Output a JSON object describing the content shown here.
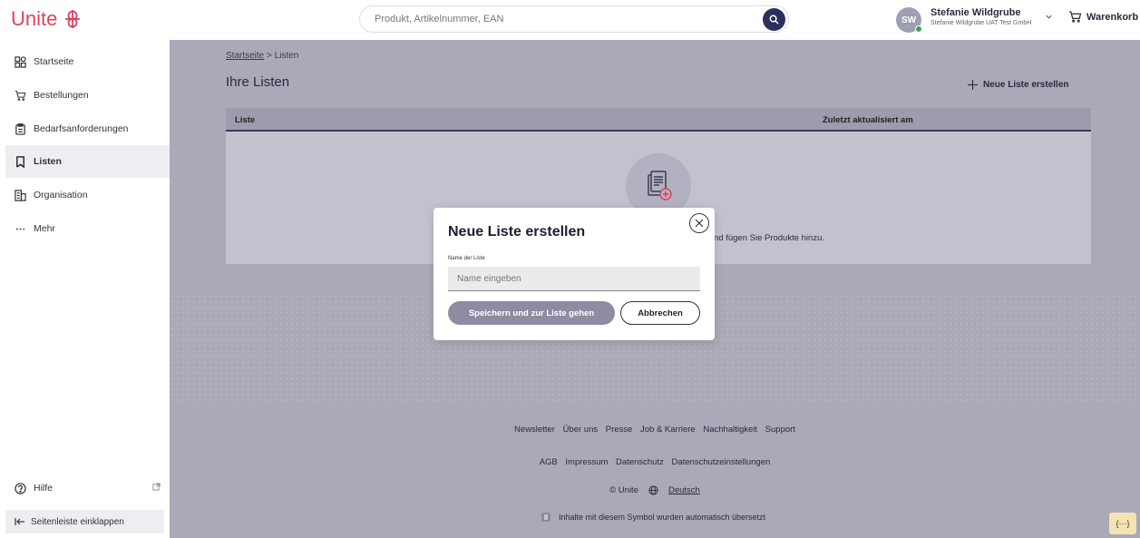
{
  "header": {
    "logo_text": "Unite",
    "search_placeholder": "Produkt, Artikelnummer, EAN",
    "user_initials": "SW",
    "user_name": "Stefanie Wildgrube",
    "user_org": "Stefanie Wildgrube UAT Test GmbH",
    "cart_label": "Warenkorb"
  },
  "sidebar": {
    "items": [
      {
        "label": "Startseite",
        "icon": "dashboard-icon"
      },
      {
        "label": "Bestellungen",
        "icon": "cart-icon"
      },
      {
        "label": "Bedarfsanforderungen",
        "icon": "clipboard-icon"
      },
      {
        "label": "Listen",
        "icon": "bookmark-icon",
        "active": true
      },
      {
        "label": "Organisation",
        "icon": "building-icon"
      },
      {
        "label": "Mehr",
        "icon": "more-icon"
      }
    ],
    "help_label": "Hilfe",
    "collapse_label": "Seitenleiste einklappen"
  },
  "main": {
    "breadcrumb_home": "Startseite",
    "breadcrumb_separator": ">",
    "breadcrumb_current": "Listen",
    "title": "Ihre Listen",
    "new_list_label": "Neue Liste erstellen",
    "table": {
      "col_name": "Liste",
      "col_updated": "Zuletzt aktualisiert am",
      "empty_text": "nd fügen Sie Produkte hinzu."
    }
  },
  "footer": {
    "links_row1": [
      "Newsletter",
      "Über uns",
      "Presse",
      "Job & Karriere",
      "Nachhaltigkeit",
      "Support"
    ],
    "links_row2": [
      "AGB",
      "Impressum",
      "Datenschutz",
      "Datenschutzeinstellungen"
    ],
    "copyright": "© Unite",
    "language": "Deutsch",
    "translation_note": "Inhalte mit diesem Symbol wurden automatisch übersetzt",
    "corner_button": "{···}"
  },
  "modal": {
    "title": "Neue Liste erstellen",
    "field_label": "Name der Liste",
    "field_placeholder": "Name eingeben",
    "field_value": "",
    "save_label": "Speichern und zur Liste gehen",
    "cancel_label": "Abbrechen"
  },
  "colors": {
    "brand": "#e0435e",
    "navy": "#2c2e5e",
    "overlay": "#a9a9b8",
    "save_button": "#8d8ca3"
  }
}
